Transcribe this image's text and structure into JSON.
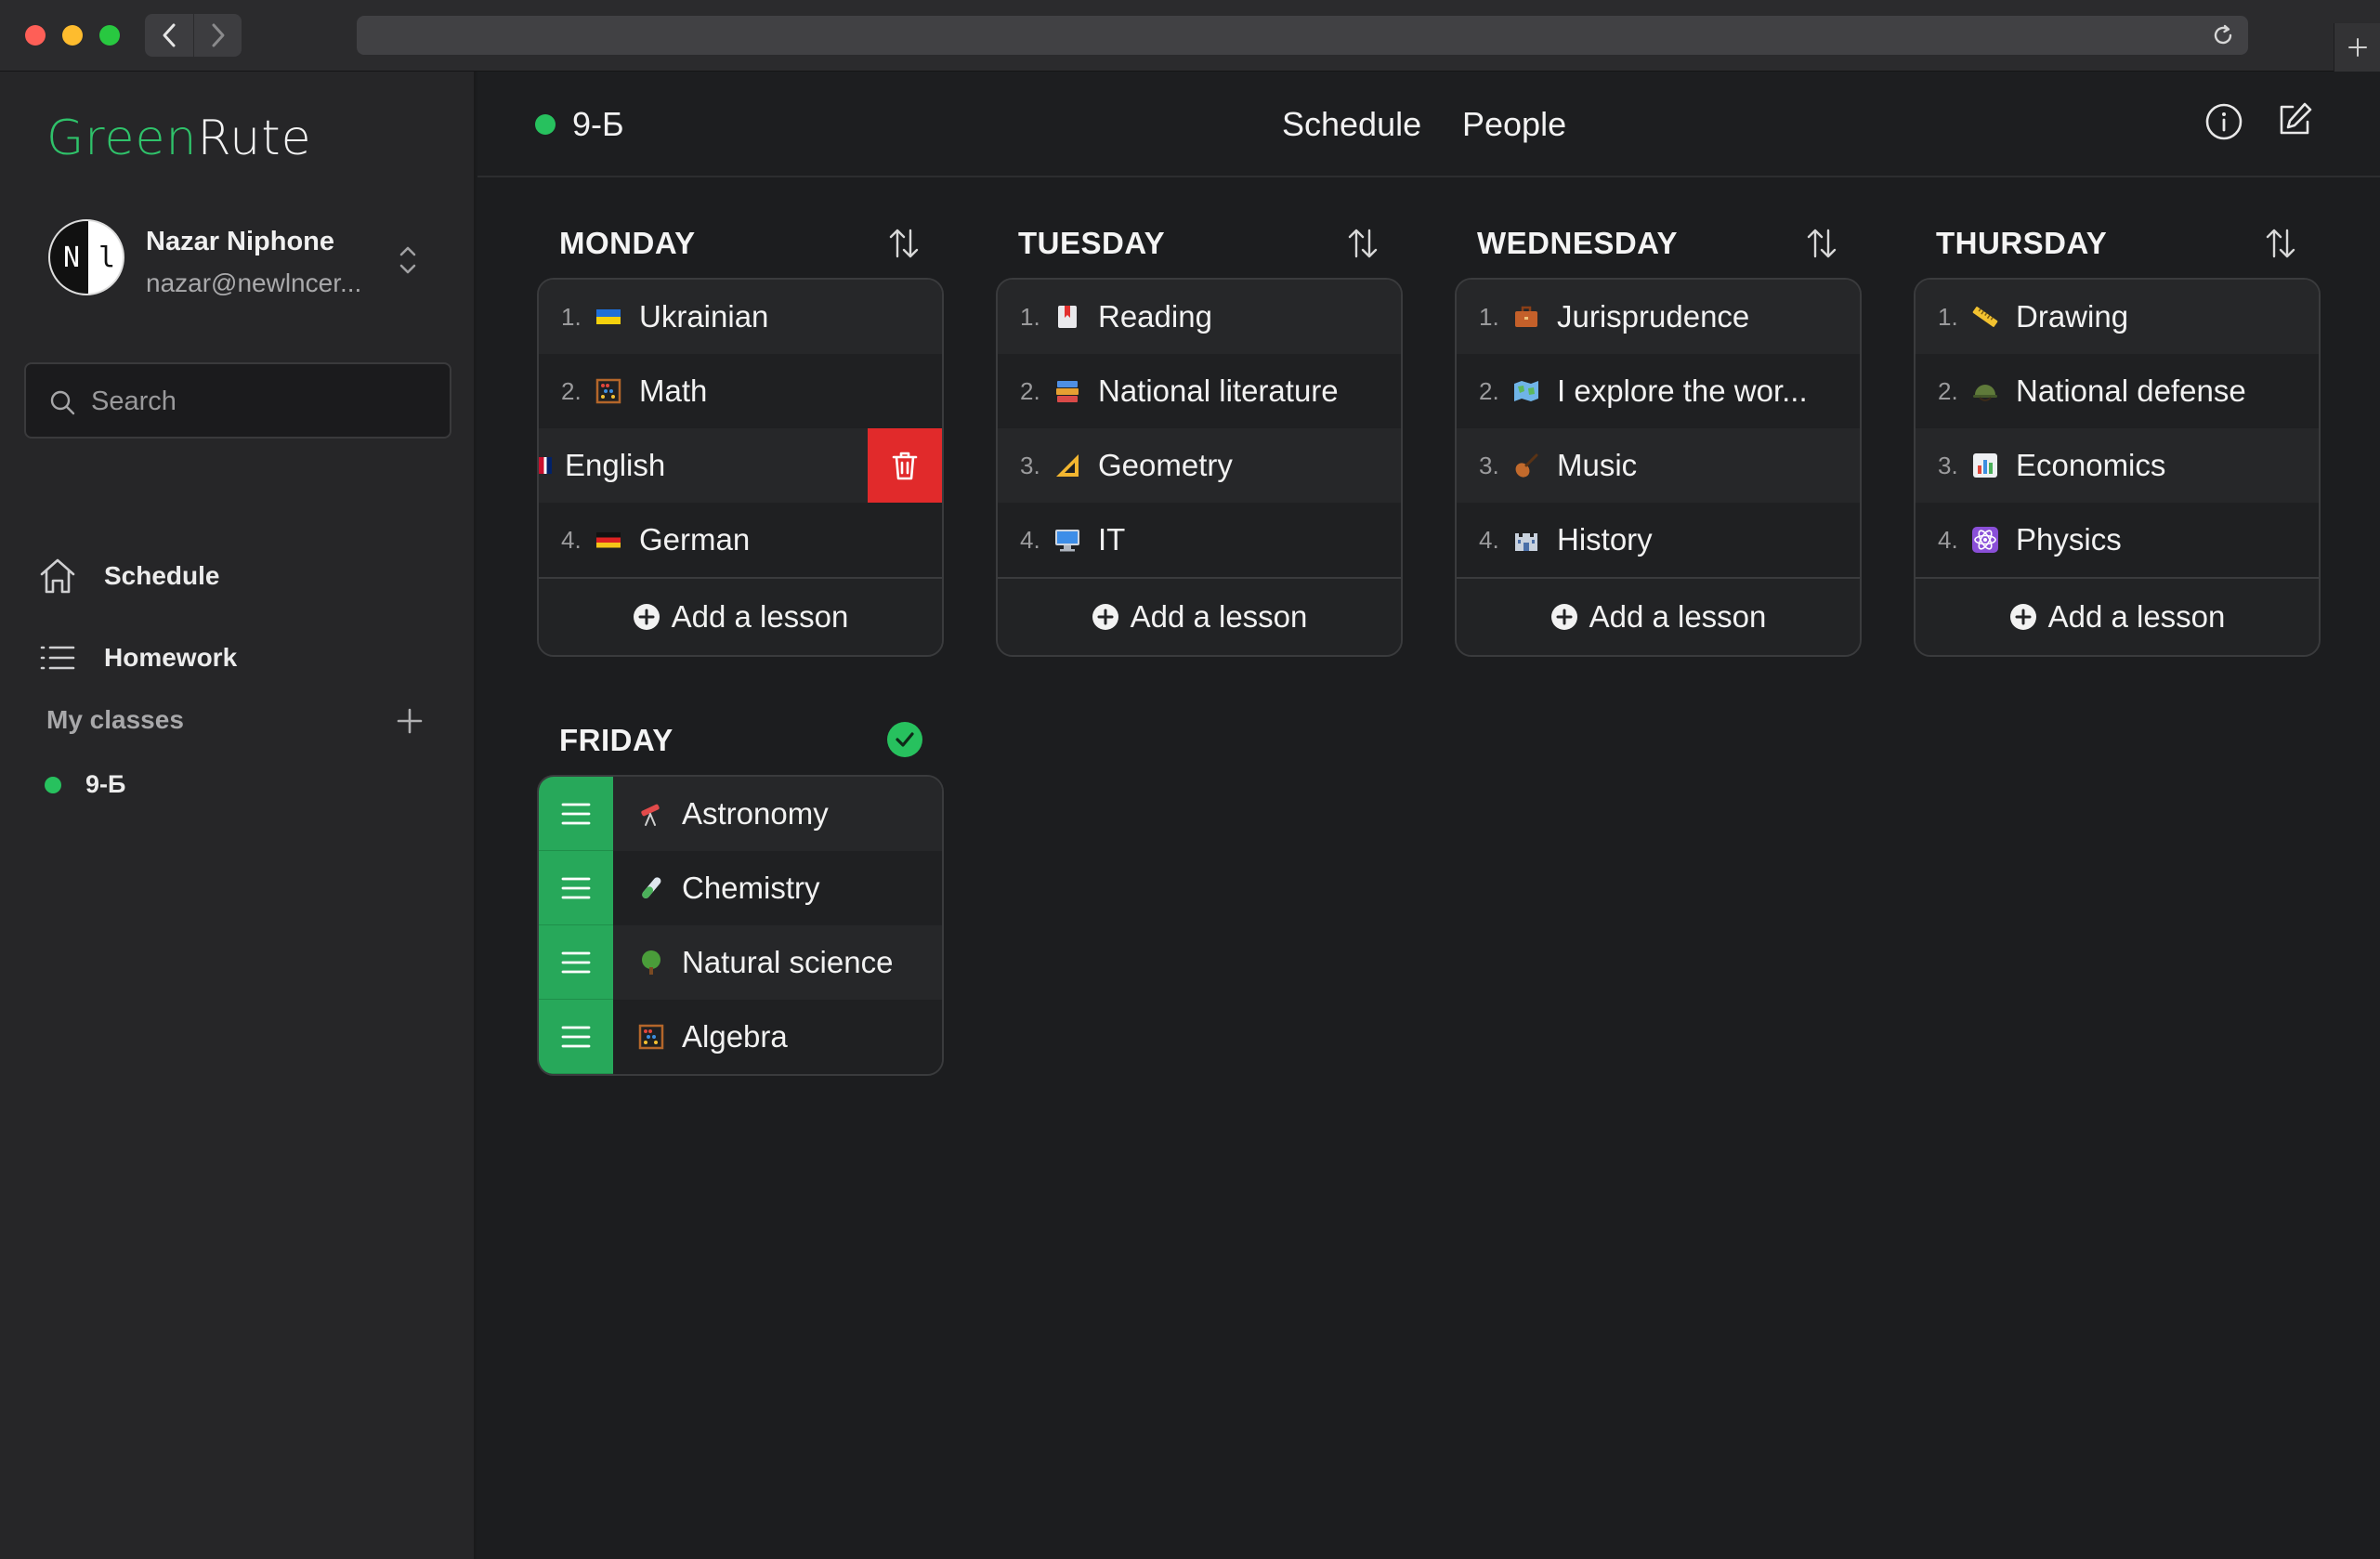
{
  "app": {
    "name_part1": "Green",
    "name_part2": "Rute"
  },
  "user": {
    "name": "Nazar Niphone",
    "email": "nazar@newlncer...",
    "avatar_letters": [
      "N",
      "l"
    ]
  },
  "search": {
    "placeholder": "Search"
  },
  "sidebar": {
    "items": [
      {
        "label": "Schedule",
        "icon": "home-icon"
      },
      {
        "label": "Homework",
        "icon": "list-icon"
      }
    ],
    "my_classes_label": "My classes",
    "classes": [
      {
        "label": "9-Б",
        "color": "#27c15e"
      }
    ]
  },
  "header": {
    "class_label": "9-Б",
    "tabs": [
      {
        "label": "Schedule"
      },
      {
        "label": "People"
      }
    ]
  },
  "add_lesson_label": "Add a lesson",
  "days": [
    {
      "name": "MONDAY",
      "lessons": [
        {
          "num": "1.",
          "emoji": "ukraine-flag",
          "label": "Ukrainian"
        },
        {
          "num": "2.",
          "emoji": "abacus",
          "label": "Math"
        },
        {
          "num": "",
          "emoji": "uk-flag",
          "label": "English"
        },
        {
          "num": "4.",
          "emoji": "germany-flag",
          "label": "German"
        }
      ]
    },
    {
      "name": "TUESDAY",
      "lessons": [
        {
          "num": "1.",
          "emoji": "bookmark",
          "label": "Reading"
        },
        {
          "num": "2.",
          "emoji": "books",
          "label": "National literature"
        },
        {
          "num": "3.",
          "emoji": "triangle-ruler",
          "label": "Geometry"
        },
        {
          "num": "4.",
          "emoji": "computer",
          "label": "IT"
        }
      ]
    },
    {
      "name": "WEDNESDAY",
      "lessons": [
        {
          "num": "1.",
          "emoji": "briefcase",
          "label": "Jurisprudence"
        },
        {
          "num": "2.",
          "emoji": "map",
          "label": "I explore the wor..."
        },
        {
          "num": "3.",
          "emoji": "violin",
          "label": "Music"
        },
        {
          "num": "4.",
          "emoji": "castle",
          "label": "History"
        }
      ]
    },
    {
      "name": "THURSDAY",
      "lessons": [
        {
          "num": "1.",
          "emoji": "ruler",
          "label": "Drawing"
        },
        {
          "num": "2.",
          "emoji": "military-helmet",
          "label": "National defense"
        },
        {
          "num": "3.",
          "emoji": "bar-chart",
          "label": "Economics"
        },
        {
          "num": "4.",
          "emoji": "atom",
          "label": "Physics"
        }
      ]
    },
    {
      "name": "FRIDAY",
      "lessons": [
        {
          "emoji": "telescope",
          "label": "Astronomy"
        },
        {
          "emoji": "test-tube",
          "label": "Chemistry"
        },
        {
          "emoji": "tree",
          "label": "Natural science"
        },
        {
          "emoji": "abacus",
          "label": "Algebra"
        }
      ]
    }
  ],
  "colors": {
    "accent": "#27c15e",
    "delete": "#e12a2b",
    "handle": "#27a85a"
  }
}
